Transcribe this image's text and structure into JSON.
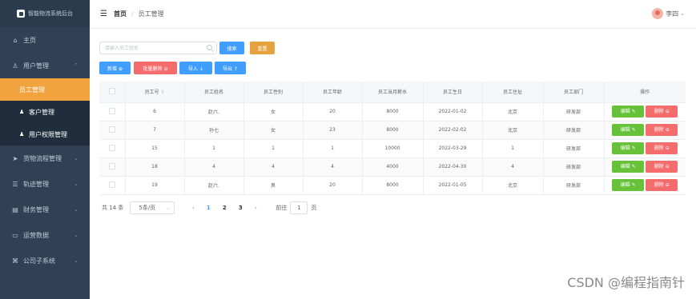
{
  "app": {
    "title": "智能物流系统后台"
  },
  "sidebar": {
    "items": [
      {
        "label": "主页",
        "icon": "home-icon",
        "glyph": "⌂"
      },
      {
        "label": "用户管理",
        "icon": "user-icon",
        "glyph": "♙",
        "expanded": true,
        "children": [
          {
            "label": "员工管理",
            "active": true
          },
          {
            "label": "客户管理"
          },
          {
            "label": "用户权限管理"
          }
        ]
      },
      {
        "label": "货物流程管理",
        "icon": "send-icon",
        "glyph": "➤"
      },
      {
        "label": "轨迹管理",
        "icon": "sliders-icon",
        "glyph": "☰"
      },
      {
        "label": "财务管理",
        "icon": "ledger-icon",
        "glyph": "▤"
      },
      {
        "label": "运营数据",
        "icon": "monitor-icon",
        "glyph": "▭"
      },
      {
        "label": "公司子系统",
        "icon": "chat-icon",
        "glyph": "⌘"
      }
    ]
  },
  "header": {
    "breadcrumb_home": "首页",
    "breadcrumb_sep": "/",
    "breadcrumb_current": "员工管理",
    "user_name": "李四"
  },
  "toolbar": {
    "search_placeholder": "请输入员工姓名",
    "search_label": "搜索",
    "reset_label": "重置",
    "add_label": "新增 ⊕",
    "batch_delete_label": "批量删除 ⊖",
    "import_label": "导入 ↓",
    "export_label": "导出 ↑"
  },
  "table": {
    "headers": [
      "员工号",
      "员工姓名",
      "员工性别",
      "员工年龄",
      "员工当月薪水",
      "员工生日",
      "员工住址",
      "员工部门",
      "操作"
    ],
    "edit_label": "编辑 ✎",
    "delete_label": "删除 ⊖",
    "rows": [
      [
        "6",
        "赵六.",
        "女",
        "20",
        "8000",
        "2022-01-02",
        "北京",
        "研发部"
      ],
      [
        "7",
        "孙七",
        "女",
        "23",
        "8000",
        "2022-02-02",
        "北京",
        "研发部"
      ],
      [
        "15",
        "1",
        "1",
        "1",
        "10000",
        "2022-03-29",
        "1",
        "研发部"
      ],
      [
        "18",
        "4",
        "4",
        "4",
        "4000",
        "2022-04-30",
        "4",
        "研发部"
      ],
      [
        "19",
        "赵六.",
        "男",
        "20",
        "8000",
        "2022-01-05",
        "北京",
        "研发部"
      ]
    ]
  },
  "pagination": {
    "total": "共 14 条",
    "page_size": "5条/页",
    "prev": "‹",
    "pages": [
      "1",
      "2",
      "3"
    ],
    "current_page": "1",
    "next": "›",
    "goto_label": "前往",
    "goto_value": "1",
    "goto_suffix": "页"
  },
  "watermark": "CSDN @编程指南针",
  "colors": {
    "sidebar": "#304156",
    "primary": "#409eff",
    "warning": "#e6a23c",
    "danger": "#f56c6c",
    "success": "#67c23a",
    "active_menu": "#f0a33e"
  }
}
